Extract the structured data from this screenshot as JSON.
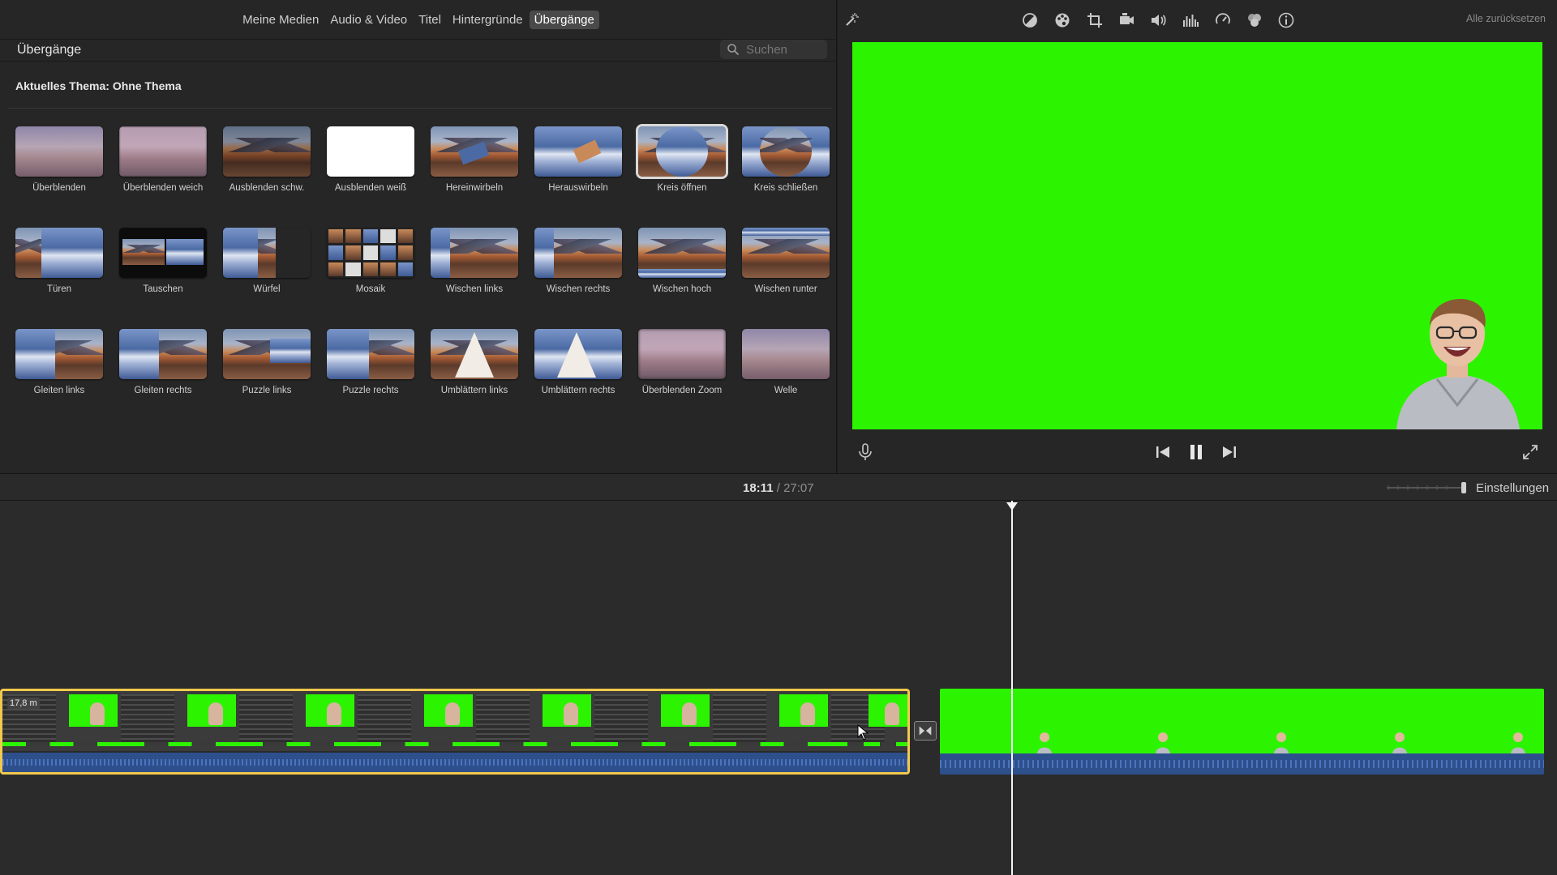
{
  "browser": {
    "tabs": [
      {
        "label": "Meine Medien"
      },
      {
        "label": "Audio & Video"
      },
      {
        "label": "Titel"
      },
      {
        "label": "Hintergründe"
      },
      {
        "label": "Übergänge"
      }
    ],
    "active_tab": "Übergänge",
    "title": "Übergänge",
    "search_placeholder": "Suchen",
    "theme_label": "Aktuelles Thema: Ohne Thema",
    "transitions": [
      {
        "label": "Überblenden"
      },
      {
        "label": "Überblenden weich"
      },
      {
        "label": "Ausblenden schw."
      },
      {
        "label": "Ausblenden weiß"
      },
      {
        "label": "Hereinwirbeln"
      },
      {
        "label": "Herauswirbeln"
      },
      {
        "label": "Kreis öffnen"
      },
      {
        "label": "Kreis schließen"
      },
      {
        "label": "Türen"
      },
      {
        "label": "Tauschen"
      },
      {
        "label": "Würfel"
      },
      {
        "label": "Mosaik"
      },
      {
        "label": "Wischen links"
      },
      {
        "label": "Wischen rechts"
      },
      {
        "label": "Wischen hoch"
      },
      {
        "label": "Wischen runter"
      },
      {
        "label": "Gleiten links"
      },
      {
        "label": "Gleiten rechts"
      },
      {
        "label": "Puzzle links"
      },
      {
        "label": "Puzzle rechts"
      },
      {
        "label": "Umblättern links"
      },
      {
        "label": "Umblättern rechts"
      },
      {
        "label": "Überblenden Zoom"
      },
      {
        "label": "Welle"
      }
    ],
    "selected_transition": "Kreis öffnen"
  },
  "viewer": {
    "reset_label": "Alle zurücksetzen",
    "toolbar_icons": [
      "magic-wand-icon",
      "color-balance-icon",
      "color-palette-icon",
      "crop-icon",
      "stabilization-camera-icon",
      "volume-icon",
      "equalizer-icon",
      "speed-icon",
      "filter-icon",
      "info-icon"
    ],
    "preview_background": "#2cf400"
  },
  "timeline": {
    "current_time": "18:11",
    "separator": "/",
    "total_time": "27:07",
    "settings_label": "Einstellungen",
    "clip_duration_badge": "17,8 m",
    "selection_color": "#f2c94c",
    "audio_color": "#2d4f8c"
  }
}
